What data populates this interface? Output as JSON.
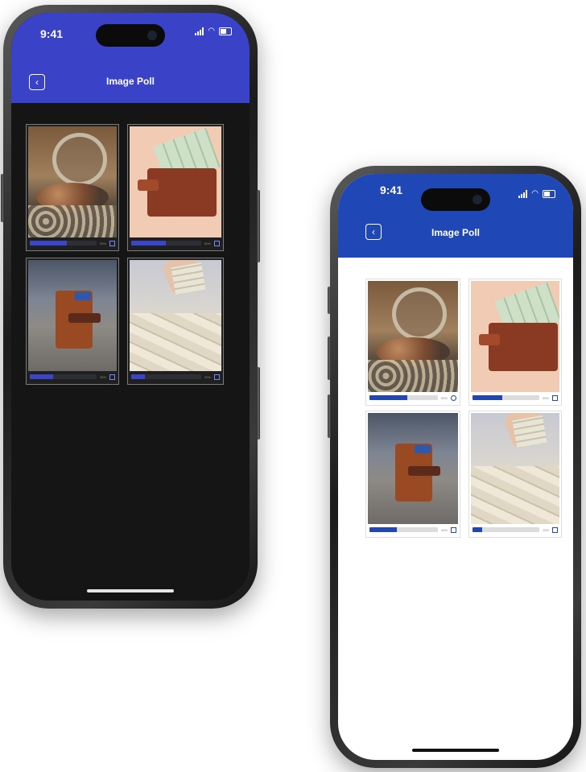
{
  "status_time": "9:41",
  "screen_title": "Image Poll",
  "back_icon": "chevron-left-icon",
  "phones": [
    {
      "theme": "dark",
      "accent": "#3a42c8",
      "options": [
        {
          "image": "coins-jar",
          "progress": 0.55,
          "pct": "55%"
        },
        {
          "image": "wallet-cash",
          "progress": 0.5,
          "pct": "50%"
        },
        {
          "image": "card-wallet",
          "progress": 0.35,
          "pct": "35%"
        },
        {
          "image": "bills",
          "progress": 0.2,
          "pct": "20%"
        }
      ]
    },
    {
      "theme": "light",
      "accent": "#1f47b5",
      "options": [
        {
          "image": "coins-jar",
          "progress": 0.55,
          "pct": "55%"
        },
        {
          "image": "wallet-cash",
          "progress": 0.45,
          "pct": "45%"
        },
        {
          "image": "card-wallet",
          "progress": 0.4,
          "pct": "40%"
        },
        {
          "image": "bills",
          "progress": 0.15,
          "pct": "15%"
        }
      ]
    }
  ]
}
